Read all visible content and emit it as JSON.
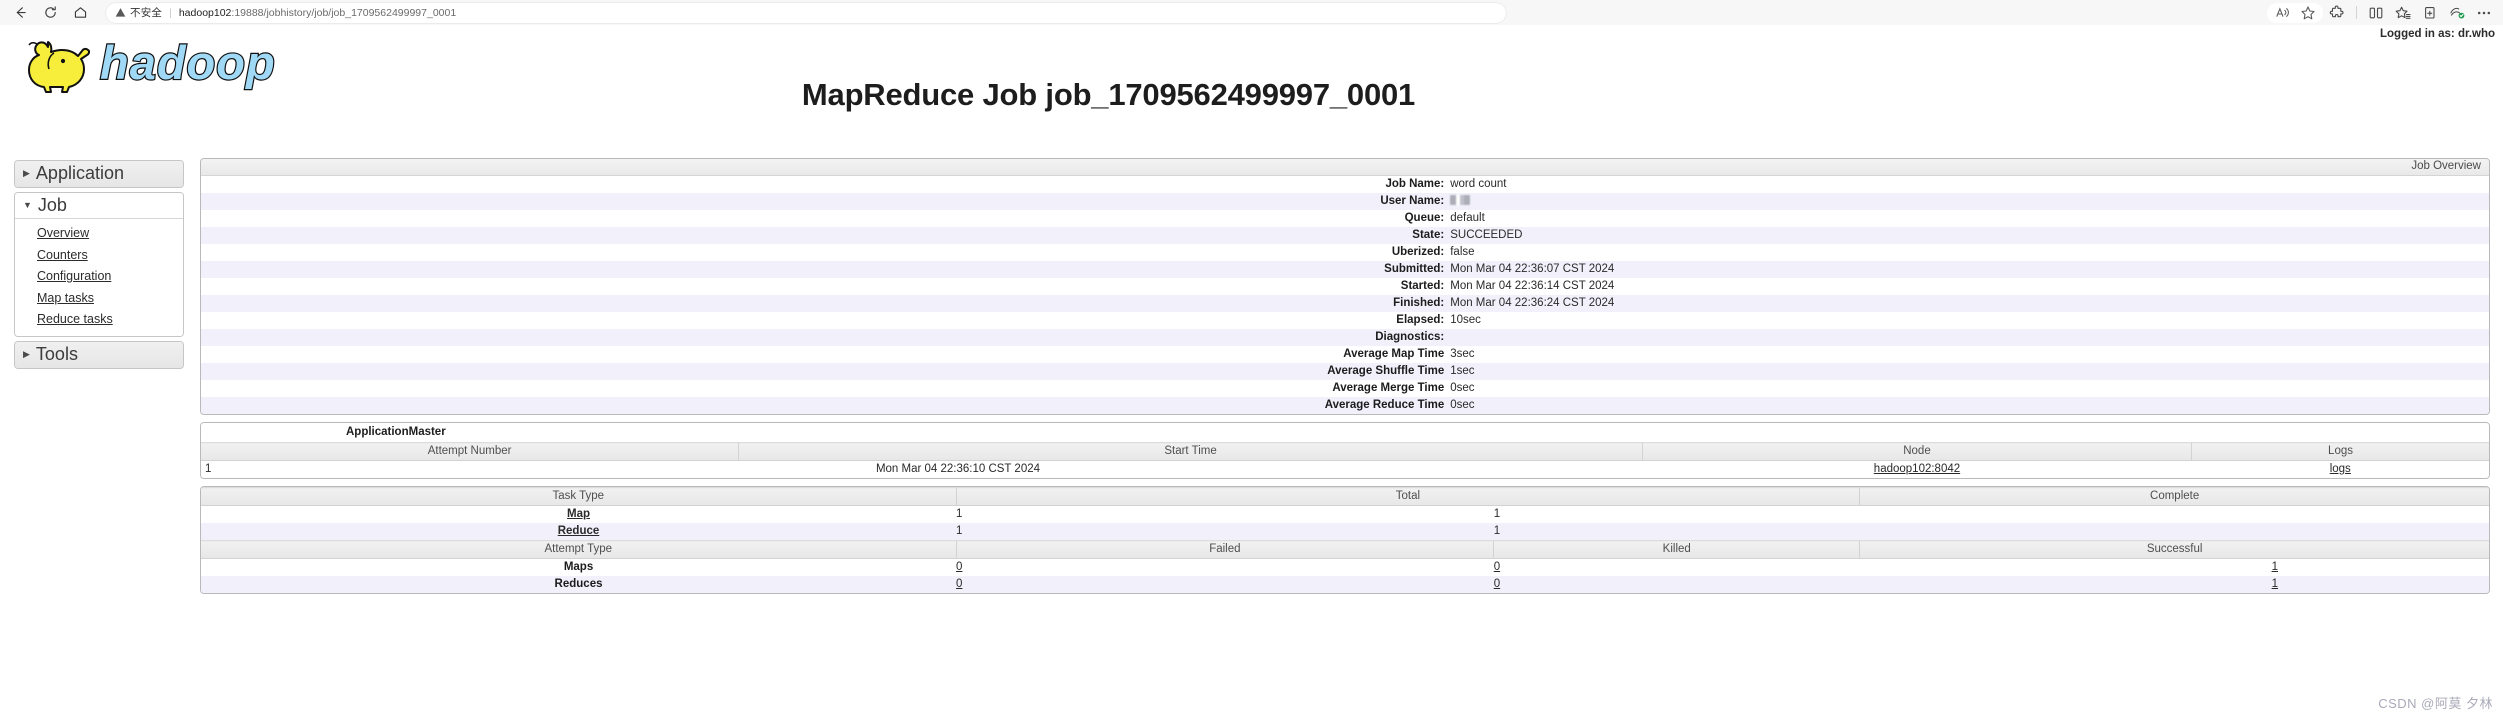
{
  "browser": {
    "back_tooltip": "Back",
    "refresh_tooltip": "Refresh",
    "home_tooltip": "Home",
    "security_label": "不安全",
    "url_host": "hadoop102",
    "url_rest": ":19888/jobhistory/job/job_1709562499997_0001"
  },
  "header": {
    "logo_text": "hadoop",
    "page_title": "MapReduce Job job_1709562499997_0001",
    "logged_in": "Logged in as: dr.who"
  },
  "sidebar": {
    "groups": [
      {
        "label": "Application",
        "expanded": false,
        "items": []
      },
      {
        "label": "Job",
        "expanded": true,
        "items": [
          "Overview",
          "Counters",
          "Configuration",
          "Map tasks",
          "Reduce tasks"
        ]
      },
      {
        "label": "Tools",
        "expanded": false,
        "items": []
      }
    ]
  },
  "job_overview": {
    "caption": "Job Overview",
    "rows": [
      {
        "key": "Job Name:",
        "value": "word count"
      },
      {
        "key": "User Name:",
        "value": "",
        "redacted": true
      },
      {
        "key": "Queue:",
        "value": "default"
      },
      {
        "key": "State:",
        "value": "SUCCEEDED"
      },
      {
        "key": "Uberized:",
        "value": "false"
      },
      {
        "key": "Submitted:",
        "value": "Mon Mar 04 22:36:07 CST 2024"
      },
      {
        "key": "Started:",
        "value": "Mon Mar 04 22:36:14 CST 2024"
      },
      {
        "key": "Finished:",
        "value": "Mon Mar 04 22:36:24 CST 2024"
      },
      {
        "key": "Elapsed:",
        "value": "10sec"
      },
      {
        "key": "Diagnostics:",
        "value": ""
      },
      {
        "key": "Average Map Time",
        "value": "3sec"
      },
      {
        "key": "Average Shuffle Time",
        "value": "1sec"
      },
      {
        "key": "Average Merge Time",
        "value": "0sec"
      },
      {
        "key": "Average Reduce Time",
        "value": "0sec"
      }
    ]
  },
  "application_master": {
    "title": "ApplicationMaster",
    "headers": [
      "Attempt Number",
      "Start Time",
      "Node",
      "Logs"
    ],
    "row": {
      "attempt_number": "1",
      "start_time": "Mon Mar 04 22:36:10 CST 2024",
      "node": "hadoop102:8042",
      "logs": "logs"
    }
  },
  "task_table": {
    "task_headers": [
      "Task Type",
      "Total",
      "Complete"
    ],
    "task_rows": [
      {
        "type": "Map",
        "total": "1",
        "complete": "1"
      },
      {
        "type": "Reduce",
        "total": "1",
        "complete": "1"
      }
    ],
    "attempt_headers": [
      "Attempt Type",
      "Failed",
      "Killed",
      "Successful"
    ],
    "attempt_rows": [
      {
        "type": "Maps",
        "failed": "0",
        "killed": "0",
        "successful": "1"
      },
      {
        "type": "Reduces",
        "failed": "0",
        "killed": "0",
        "successful": "1"
      }
    ]
  },
  "watermark": "CSDN @阿莫 夕林"
}
